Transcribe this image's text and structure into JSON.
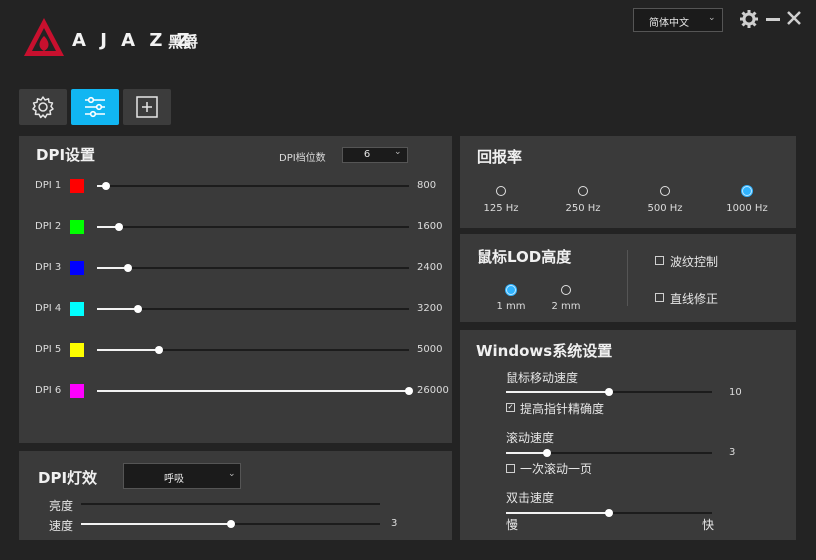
{
  "header": {
    "brand": "A J A Z Z",
    "brand_cn": "黑爵",
    "language": "简体中文",
    "icons": [
      "settings-gear-icon",
      "minimize-icon",
      "close-icon"
    ]
  },
  "tabs": [
    {
      "icon": "gear-icon",
      "active": false
    },
    {
      "icon": "sliders-icon",
      "active": true
    },
    {
      "icon": "plus-square-icon",
      "active": false
    }
  ],
  "dpi_settings": {
    "title": "DPI设置",
    "levels_label": "DPI档位数",
    "levels_value": "6",
    "rows": [
      {
        "label": "DPI 1",
        "color": "#ff0000",
        "value": "800",
        "percent": 3
      },
      {
        "label": "DPI 2",
        "color": "#00ff00",
        "value": "1600",
        "percent": 7
      },
      {
        "label": "DPI 3",
        "color": "#0000ff",
        "value": "2400",
        "percent": 10
      },
      {
        "label": "DPI 4",
        "color": "#00ffff",
        "value": "3200",
        "percent": 13
      },
      {
        "label": "DPI 5",
        "color": "#ffff00",
        "value": "5000",
        "percent": 20
      },
      {
        "label": "DPI 6",
        "color": "#ff00ff",
        "value": "26000",
        "percent": 100
      }
    ]
  },
  "dpi_light": {
    "title": "DPI灯效",
    "mode": "呼吸",
    "brightness_label": "亮度",
    "brightness_percent": 0,
    "speed_label": "速度",
    "speed_value": "3",
    "speed_percent": 50
  },
  "report_rate": {
    "title": "回报率",
    "options": [
      {
        "label": "125 Hz",
        "selected": false
      },
      {
        "label": "250 Hz",
        "selected": false
      },
      {
        "label": "500 Hz",
        "selected": false
      },
      {
        "label": "1000 Hz",
        "selected": true
      }
    ]
  },
  "lod": {
    "title": "鼠标LOD高度",
    "options": [
      {
        "label": "1 mm",
        "selected": true
      },
      {
        "label": "2 mm",
        "selected": false
      }
    ],
    "ripple_label": "波纹控制",
    "ripple_checked": false,
    "angle_label": "直线修正",
    "angle_checked": false
  },
  "windows": {
    "title": "Windows系统设置",
    "move_speed_label": "鼠标移动速度",
    "move_speed_value": "10",
    "move_speed_percent": 50,
    "precision_label": "提高指针精确度",
    "precision_checked": true,
    "scroll_label": "滚动速度",
    "scroll_value": "3",
    "scroll_percent": 20,
    "scroll_page_label": "一次滚动一页",
    "scroll_page_checked": false,
    "dblclick_label": "双击速度",
    "dblclick_percent": 50,
    "slow_label": "慢",
    "fast_label": "快"
  }
}
